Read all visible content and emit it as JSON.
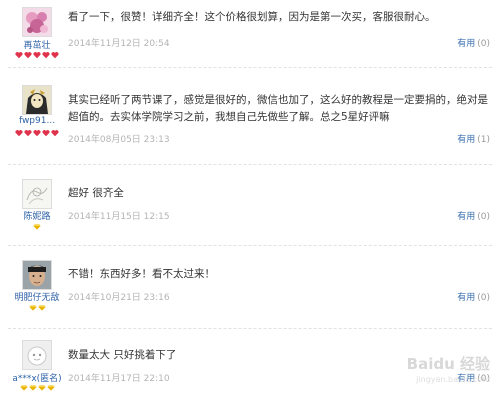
{
  "reviews": [
    {
      "username": "再茁壮",
      "avatar": "pink-flower-avatar",
      "level_icons": 5,
      "level_color": "#e0334b",
      "content": "看了一下，很赞！详细齐全！这个价格很划算，因为是第一次买，客服很耐心。",
      "date": "2014年11月12日 20:54",
      "useful_label": "有用",
      "useful_count": "(0)"
    },
    {
      "username": "fwp91...",
      "avatar": "anime-character-avatar",
      "level_icons": 5,
      "level_color": "#e0334b",
      "content": "其实已经听了两节课了，感觉是很好的，微信也加了，这么好的教程是一定要捐的，绝对是超值的。去实体学院学习之前，我想自己先做些了解。总之5星好评嘛",
      "date": "2014年08月05日 23:13",
      "useful_label": "有用",
      "useful_count": "(1)"
    },
    {
      "username": "陈妮路",
      "avatar": "sketch-avatar",
      "level_icons": 1,
      "level_color": "#e8b400",
      "content": "超好 很齐全",
      "date": "2014年11月15日 12:15",
      "useful_label": "有用",
      "useful_count": "(0)"
    },
    {
      "username": "明肥仔无敌",
      "avatar": "man-photo-avatar",
      "level_icons": 2,
      "level_color": "#e8b400",
      "content": "不错！东西好多！看不太过来！",
      "date": "2014年10月21日 23:16",
      "useful_label": "有用",
      "useful_count": "(0)"
    },
    {
      "username": "a***x(匿名)",
      "avatar": "default-anonymous-avatar",
      "level_icons": 4,
      "level_color": "#e8b400",
      "content": "数量太大 只好挑着下了",
      "date": "2014年11月17日 22:10",
      "useful_label": "有用",
      "useful_count": "(0)"
    }
  ],
  "watermark": {
    "text": "Baidu 经验",
    "sub": "jingyan.baidu.com"
  }
}
